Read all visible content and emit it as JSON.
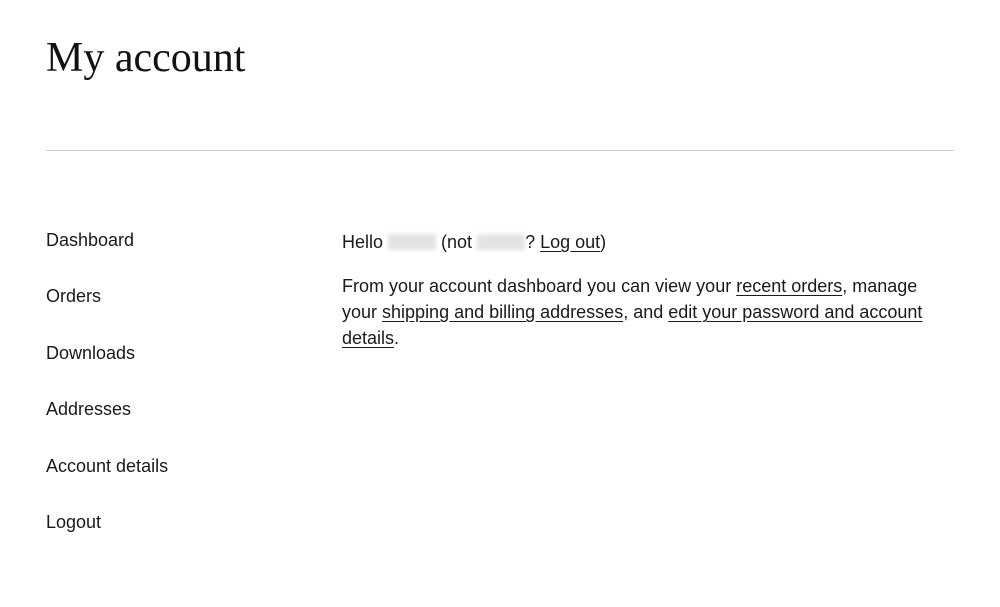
{
  "page": {
    "title": "My account"
  },
  "sidebar": {
    "items": [
      {
        "label": "Dashboard"
      },
      {
        "label": "Orders"
      },
      {
        "label": "Downloads"
      },
      {
        "label": "Addresses"
      },
      {
        "label": "Account details"
      },
      {
        "label": "Logout"
      }
    ]
  },
  "greeting": {
    "hello": "Hello ",
    "username": "[redacted]",
    "not_prefix": " (not ",
    "username2": "[redacted]",
    "q": "? ",
    "logout": "Log out",
    "close": ")"
  },
  "blurb": {
    "p_start": "From your account dashboard you can view your ",
    "recent_orders": "recent orders",
    "after_orders": ", manage your ",
    "shipping_addresses": "shipping and billing addresses",
    "after_addresses": ", and ",
    "edit_account": "edit your password and account details",
    "end": "."
  }
}
